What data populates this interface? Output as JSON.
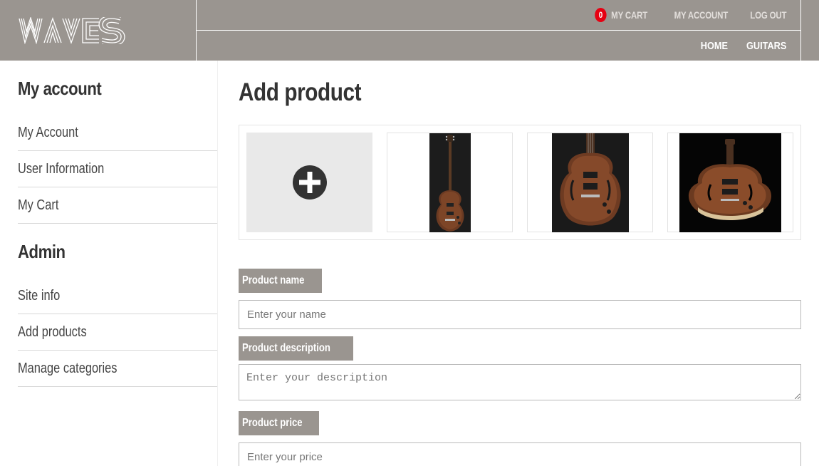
{
  "header": {
    "logo_text": "WAVES",
    "cart_count": "0",
    "top_links": {
      "cart": "MY CART",
      "account": "MY ACCOUNT",
      "logout": "LOG OUT"
    },
    "nav_links": {
      "home": "HOME",
      "guitars": "GUITARS"
    }
  },
  "sidebar": {
    "account_heading": "My account",
    "account_items": [
      "My Account",
      "User Information",
      "My Cart"
    ],
    "admin_heading": "Admin",
    "admin_items": [
      "Site info",
      "Add products",
      "Manage categories"
    ]
  },
  "main": {
    "title": "Add product",
    "upload_icon": "plus-circle-icon",
    "product_images": [
      "guitar-front-view",
      "guitar-body-closeup",
      "guitar-angled-view"
    ],
    "form": {
      "name_label": "Product name",
      "name_placeholder": "Enter your name",
      "description_label": "Product description",
      "description_placeholder": "Enter your description",
      "price_label": "Product price",
      "price_placeholder": "Enter your price"
    }
  },
  "colors": {
    "header_bg": "#9a9590",
    "badge": "#e60012",
    "label_bg": "#9a9590"
  }
}
